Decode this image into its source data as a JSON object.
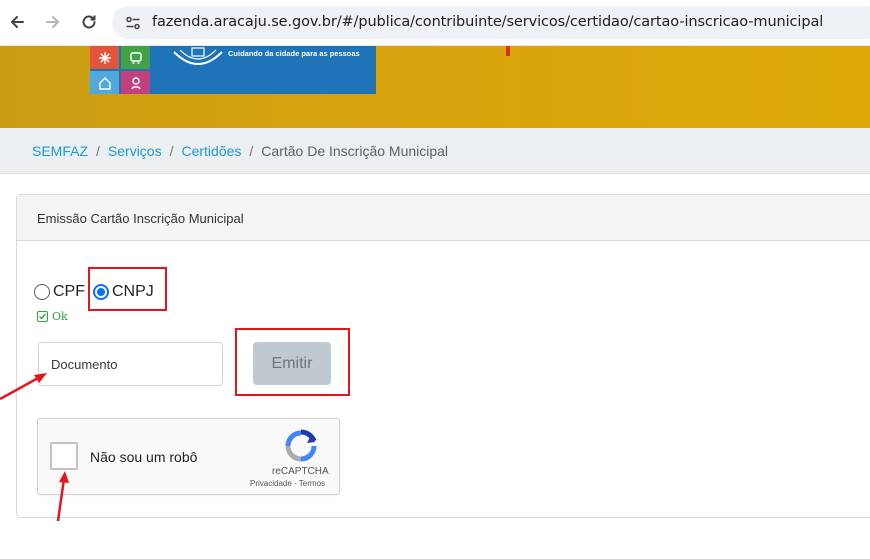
{
  "browser": {
    "url": "fazenda.aracaju.se.gov.br/#/publica/contribuinte/servicos/certidao/cartao-inscricao-municipal",
    "back_icon": "arrow-left-icon",
    "forward_icon": "arrow-right-icon",
    "reload_icon": "reload-icon",
    "site_info_icon": "tune-icon"
  },
  "banner": {
    "slogan": "Cuidando da cidade para as pessoas",
    "colors": {
      "gold": "#d8a30e",
      "logo_blue": "#1e73b9"
    }
  },
  "breadcrumb": {
    "items": [
      "SEMFAZ",
      "Serviços",
      "Certidões"
    ],
    "separator": "/",
    "current": "Cartão De Inscrição Municipal"
  },
  "card": {
    "title": "Emissão Cartão Inscrição Municipal",
    "radio": {
      "cpf_label": "CPF",
      "cnpj_label": "CNPJ",
      "selected": "CNPJ"
    },
    "status_text": "Ok",
    "document_placeholder": "Documento",
    "emit_label": "Emitir"
  },
  "recaptcha": {
    "label": "Não sou um robô",
    "brand": "reCAPTCHA",
    "privacy": "Privacidade",
    "link_sep": "-",
    "terms": "Termos"
  },
  "colors": {
    "link": "#1a9bd7",
    "accent_blue": "#0d6efd",
    "ok_green": "#28a745",
    "annotation_red": "#e8141b"
  }
}
